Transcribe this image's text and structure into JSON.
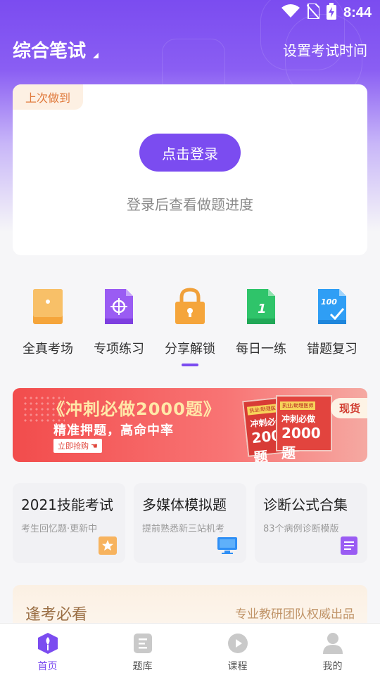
{
  "status_bar": {
    "time": "8:44",
    "icons": [
      "wifi-icon",
      "no-sim-icon",
      "battery-charging-icon"
    ]
  },
  "header": {
    "exam_title": "综合笔试",
    "set_time_label": "设置考试时间"
  },
  "progress_card": {
    "tag": "上次做到",
    "login_button": "点击登录",
    "hint": "登录后查看做题进度"
  },
  "quick_grid": [
    {
      "label": "全真考场",
      "icon": "exam-envelope-icon",
      "color": "#f5a53b"
    },
    {
      "label": "专项练习",
      "icon": "target-doc-icon",
      "color": "#9a5cf3"
    },
    {
      "label": "分享解锁",
      "icon": "padlock-icon",
      "color": "#f5a53b"
    },
    {
      "label": "每日一练",
      "icon": "daily-doc-icon",
      "color": "#2fc46a"
    },
    {
      "label": "错题复习",
      "icon": "score-doc-icon",
      "color": "#2f9ef5"
    }
  ],
  "banner": {
    "title": "《冲刺必做2000题》",
    "subtitle": "精准押题，高命中率",
    "cta": "立即抢购",
    "badge": "现货",
    "book_top": "执业/助理医师",
    "book_line": "冲刺必做",
    "book_big": "2000题"
  },
  "cards": [
    {
      "title": "2021技能考试",
      "subtitle": "考生回忆题·更新中",
      "icon": "star-icon",
      "color": "#f7b35e"
    },
    {
      "title": "多媒体模拟题",
      "subtitle": "提前熟悉新三站机考",
      "icon": "monitor-icon",
      "color": "#2f8ff5"
    },
    {
      "title": "诊断公式合集",
      "subtitle": "83个病例诊断模版",
      "icon": "document-list-icon",
      "color": "#9a5cf3"
    }
  ],
  "must_see": {
    "left": "逢考必看",
    "right": "专业教研团队权威出品"
  },
  "tabs": [
    {
      "label": "首页",
      "icon": "home-pen-icon",
      "active": true
    },
    {
      "label": "题库",
      "icon": "question-bank-icon",
      "active": false
    },
    {
      "label": "课程",
      "icon": "play-course-icon",
      "active": false
    },
    {
      "label": "我的",
      "icon": "profile-icon",
      "active": false
    }
  ],
  "colors": {
    "primary": "#7b4cf0",
    "banner_red": "#f24c4c",
    "tag_orange": "#e07a3c"
  }
}
